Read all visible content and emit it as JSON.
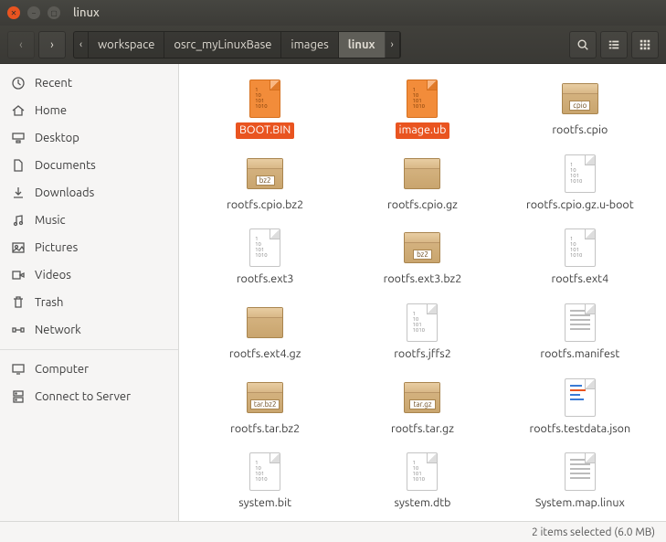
{
  "window": {
    "title": "linux"
  },
  "breadcrumb": {
    "segments": [
      "workspace",
      "osrc_myLinuxBase",
      "images",
      "linux"
    ]
  },
  "sidebar": {
    "groups": [
      [
        {
          "icon": "clock",
          "label": "Recent"
        },
        {
          "icon": "home",
          "label": "Home"
        },
        {
          "icon": "desktop",
          "label": "Desktop"
        },
        {
          "icon": "documents",
          "label": "Documents"
        },
        {
          "icon": "downloads",
          "label": "Downloads"
        },
        {
          "icon": "music",
          "label": "Music"
        },
        {
          "icon": "pictures",
          "label": "Pictures"
        },
        {
          "icon": "videos",
          "label": "Videos"
        },
        {
          "icon": "trash",
          "label": "Trash"
        },
        {
          "icon": "network",
          "label": "Network"
        }
      ],
      [
        {
          "icon": "computer",
          "label": "Computer"
        },
        {
          "icon": "server",
          "label": "Connect to Server"
        }
      ]
    ]
  },
  "files": [
    {
      "name": "BOOT.BIN",
      "kind": "binary",
      "selected": true
    },
    {
      "name": "image.ub",
      "kind": "binary",
      "selected": true
    },
    {
      "name": "rootfs.cpio",
      "kind": "package",
      "badge": "cpio"
    },
    {
      "name": "rootfs.cpio.bz2",
      "kind": "package",
      "badge": "bz2"
    },
    {
      "name": "rootfs.cpio.gz",
      "kind": "package",
      "badge": ""
    },
    {
      "name": "rootfs.cpio.gz.u-boot",
      "kind": "bintext"
    },
    {
      "name": "rootfs.ext3",
      "kind": "bintext"
    },
    {
      "name": "rootfs.ext3.bz2",
      "kind": "package",
      "badge": "bz2"
    },
    {
      "name": "rootfs.ext4",
      "kind": "bintext"
    },
    {
      "name": "rootfs.ext4.gz",
      "kind": "package",
      "badge": ""
    },
    {
      "name": "rootfs.jffs2",
      "kind": "bintext"
    },
    {
      "name": "rootfs.manifest",
      "kind": "text"
    },
    {
      "name": "rootfs.tar.bz2",
      "kind": "package",
      "badge": "tar.bz2"
    },
    {
      "name": "rootfs.tar.gz",
      "kind": "package",
      "badge": "tar.gz"
    },
    {
      "name": "rootfs.testdata.json",
      "kind": "json"
    },
    {
      "name": "system.bit",
      "kind": "bintext"
    },
    {
      "name": "system.dtb",
      "kind": "bintext"
    },
    {
      "name": "System.map.linux",
      "kind": "text"
    }
  ],
  "status": {
    "text": "2 items selected  (6.0 MB)"
  }
}
